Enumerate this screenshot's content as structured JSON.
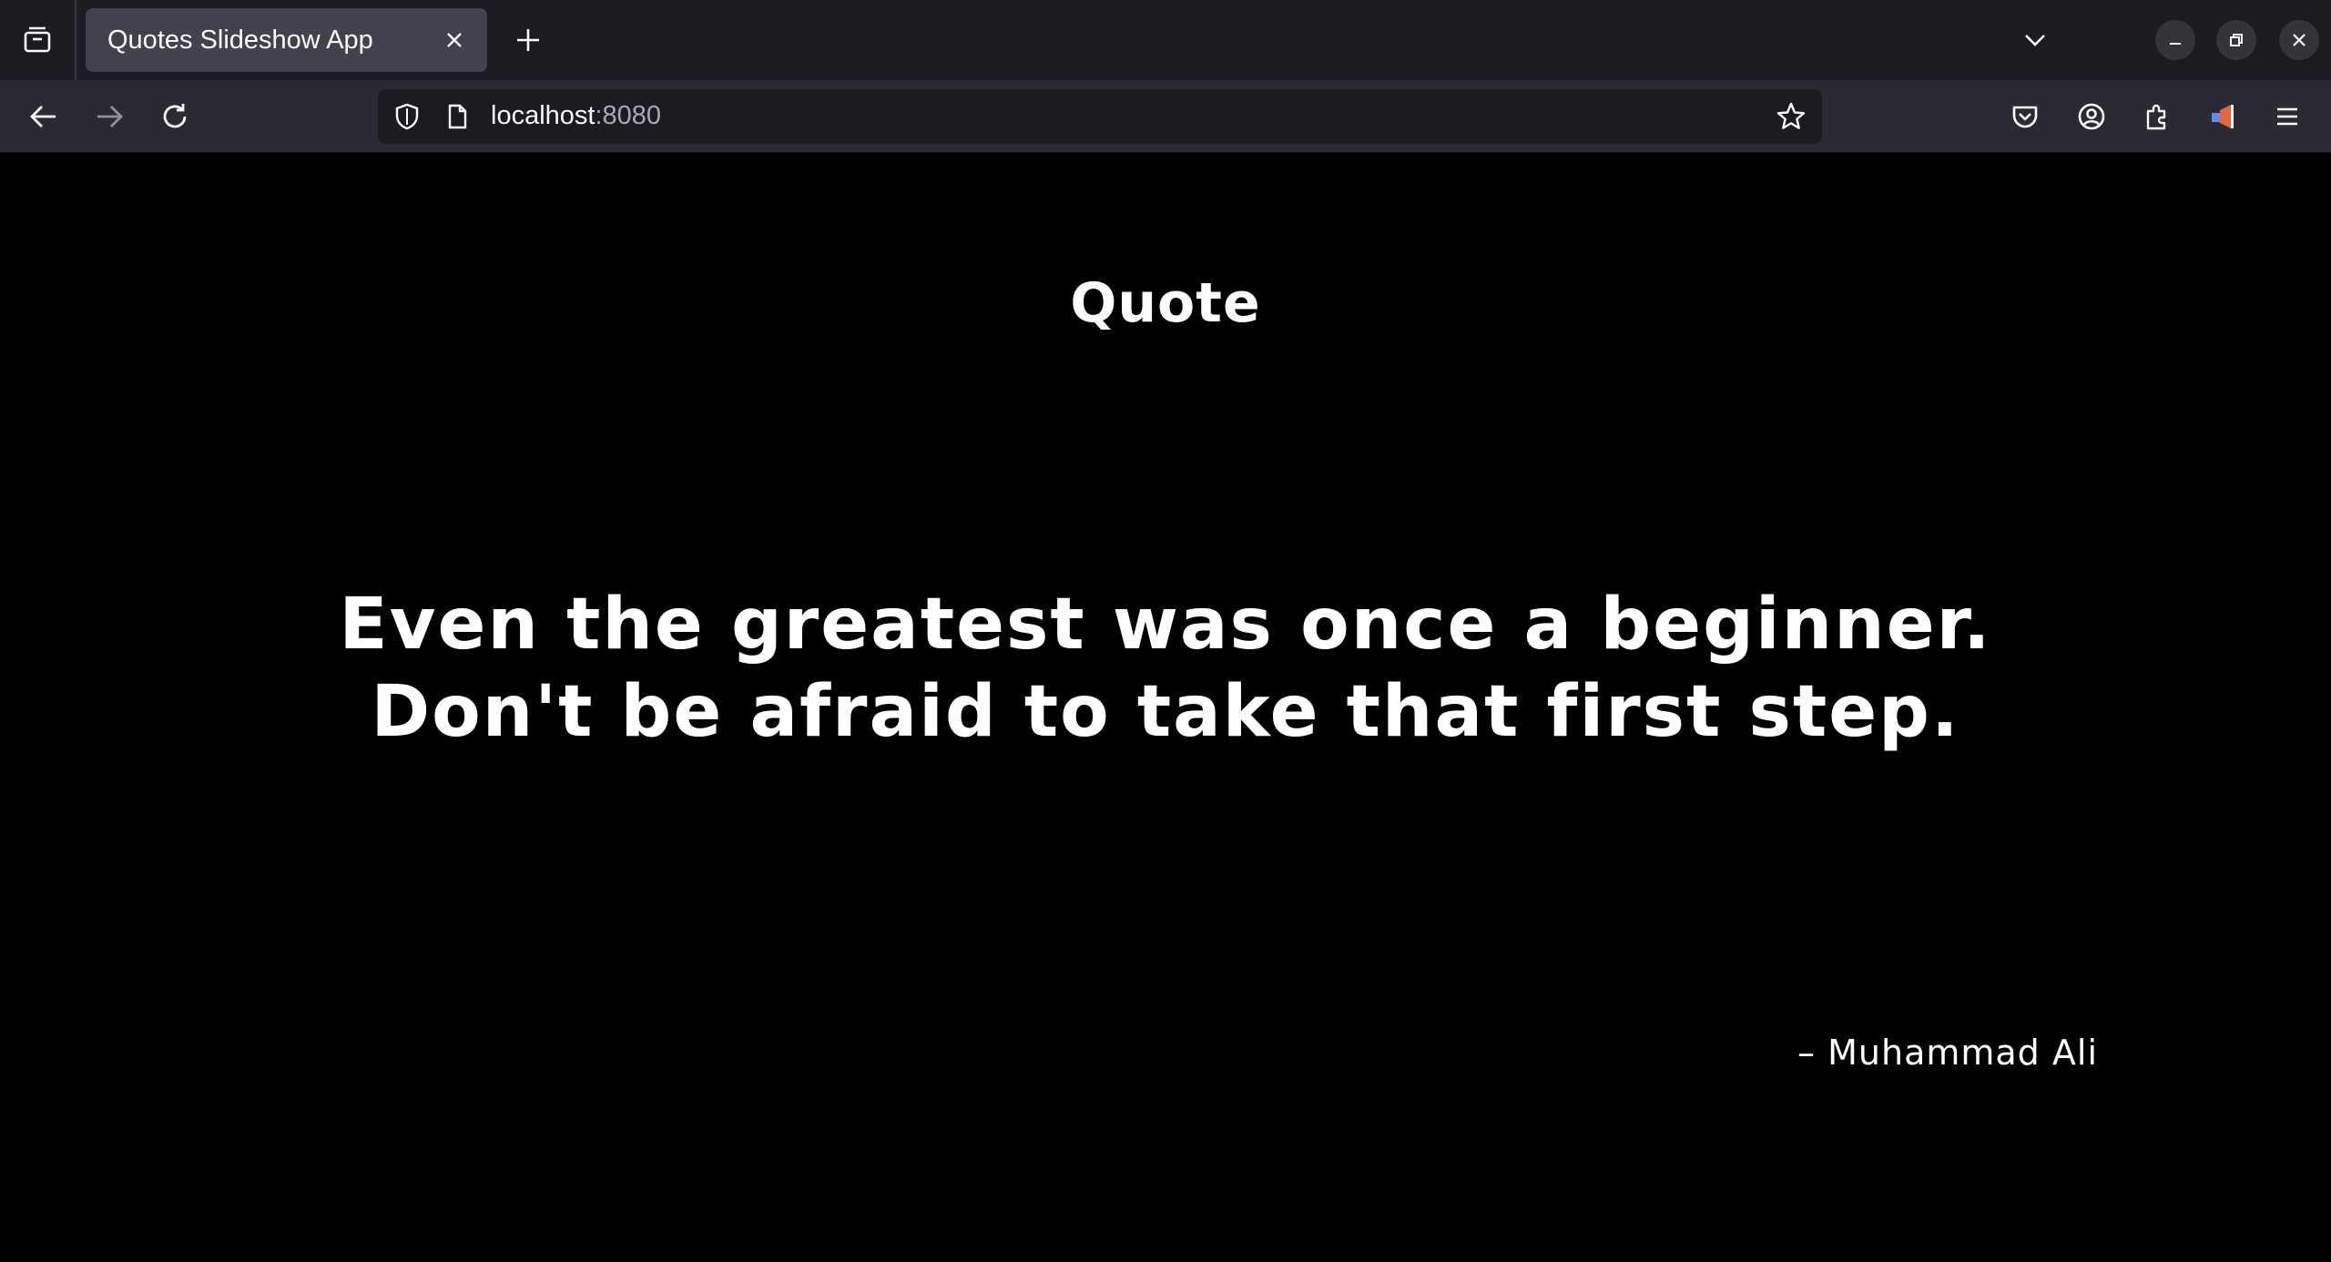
{
  "browser": {
    "tab": {
      "title": "Quotes Slideshow App"
    },
    "urlbar": {
      "host": "localhost",
      "port": ":8080"
    },
    "icons": {
      "tab_list": "tab-list-icon",
      "close": "close-icon",
      "new_tab": "plus-icon",
      "list_all_tabs": "chevron-down-icon",
      "back": "back-arrow-icon",
      "forward": "forward-arrow-icon",
      "reload": "reload-icon",
      "tracking": "shield-icon",
      "page": "page-icon",
      "bookmark": "star-icon",
      "pocket": "pocket-icon",
      "account": "account-icon",
      "extensions": "puzzle-icon",
      "extension": "extension-icon",
      "menu": "hamburger-menu-icon"
    }
  },
  "page": {
    "title": "Quote",
    "quote": "Even the greatest was once a beginner. Don't be afraid to take that first step.",
    "author": "– Muhammad Ali"
  },
  "colors": {
    "page_background": "#000000",
    "text": "#ffffff",
    "toolbar": "#2b2a33",
    "tabbar": "#1c1b22"
  }
}
